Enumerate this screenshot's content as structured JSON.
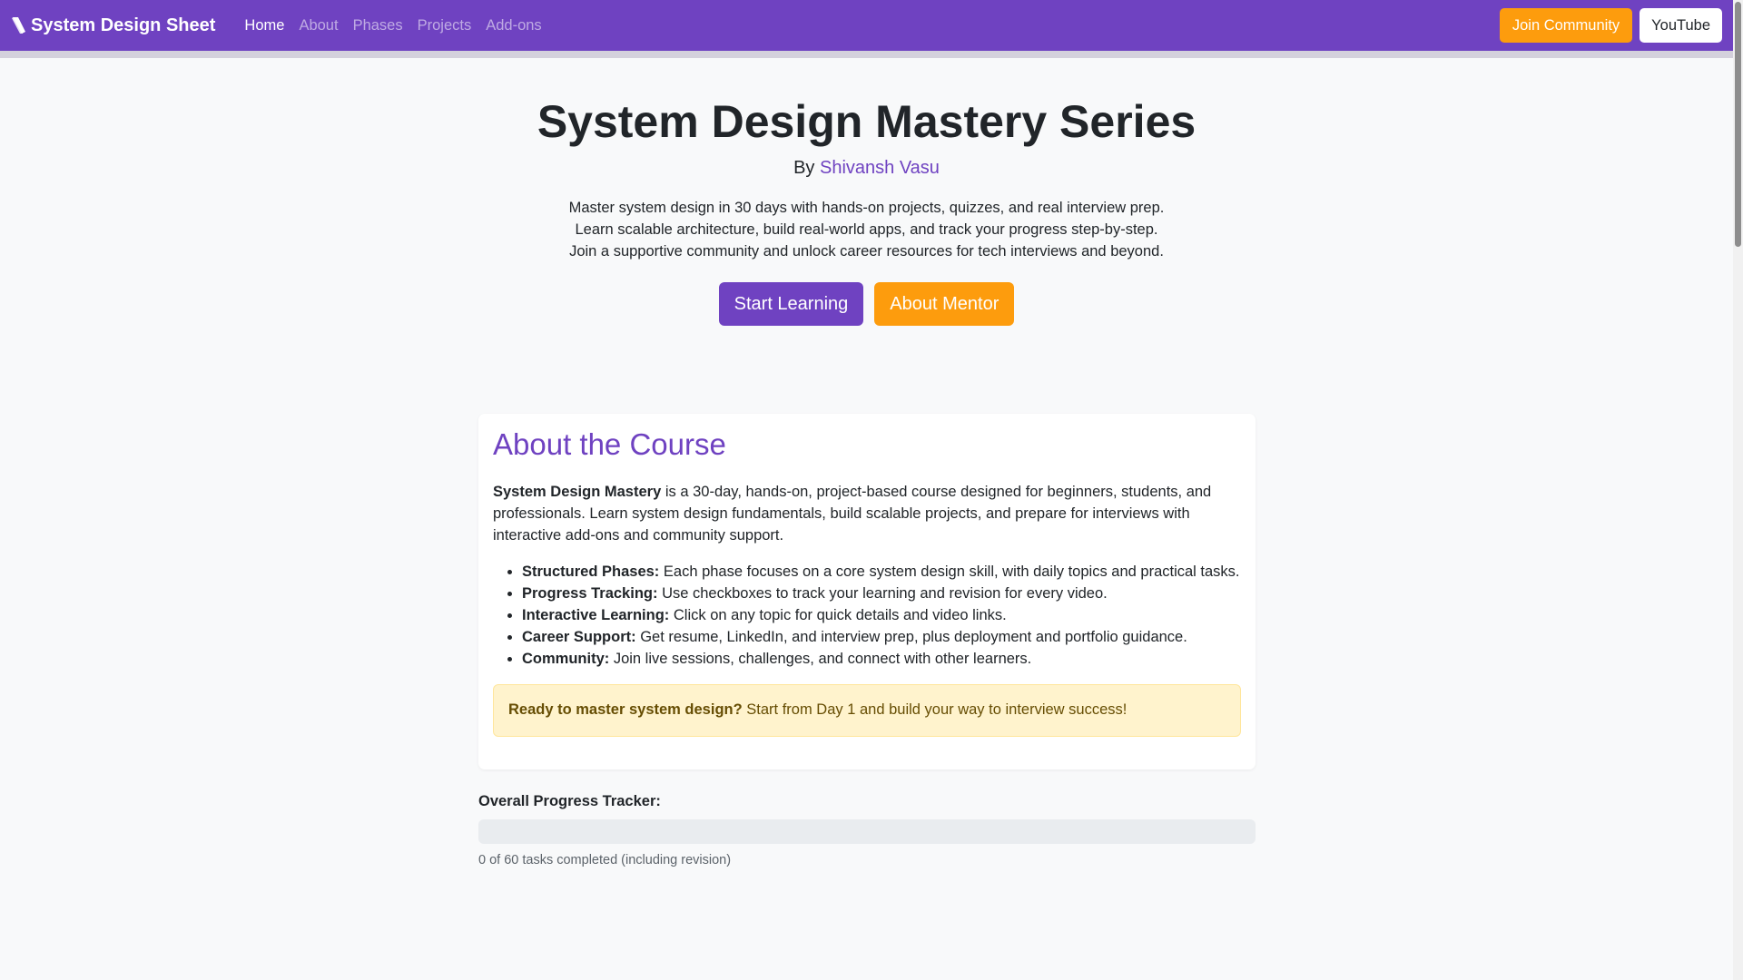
{
  "nav": {
    "brand": "System Design Sheet",
    "links": [
      "Home",
      "About",
      "Phases",
      "Projects",
      "Add-ons"
    ],
    "join_label": "Join Community",
    "youtube_label": "YouTube"
  },
  "hero": {
    "title": "System Design Mastery Series",
    "by_prefix": "By",
    "author": "Shivansh Vasu",
    "lead_lines": [
      "Master system design in 30 days with hands-on projects, quizzes, and real interview prep.",
      "Learn scalable architecture, build real-world apps, and track your progress step-by-step.",
      "Join a supportive community and unlock career resources for tech interviews and beyond."
    ],
    "start_label": "Start Learning",
    "mentor_label": "About Mentor"
  },
  "about": {
    "heading": "About the Course",
    "intro_bold": "System Design Mastery",
    "intro_rest": " is a 30-day, hands-on, project-based course designed for beginners, students, and professionals. Learn system design fundamentals, build scalable projects, and prepare for interviews with interactive add-ons and community support.",
    "features": [
      {
        "title": "Structured Phases:",
        "text": " Each phase focuses on a core system design skill, with daily topics and practical tasks."
      },
      {
        "title": "Progress Tracking:",
        "text": " Use checkboxes to track your learning and revision for every video."
      },
      {
        "title": "Interactive Learning:",
        "text": " Click on any topic for quick details and video links."
      },
      {
        "title": "Career Support:",
        "text": " Get resume, LinkedIn, and interview prep, plus deployment and portfolio guidance."
      },
      {
        "title": "Community:",
        "text": " Join live sessions, challenges, and connect with other learners."
      }
    ],
    "alert_bold": "Ready to master system design?",
    "alert_rest": " Start from Day 1 and build your way to interview success!"
  },
  "progress": {
    "label": "Overall Progress Tracker:",
    "completed": 0,
    "total": 60,
    "text": "0 of 60 tasks completed (including revision)"
  },
  "colors": {
    "primary": "#6f42c1",
    "accent": "#fd9c0d",
    "alert_bg": "#fff3cd"
  }
}
